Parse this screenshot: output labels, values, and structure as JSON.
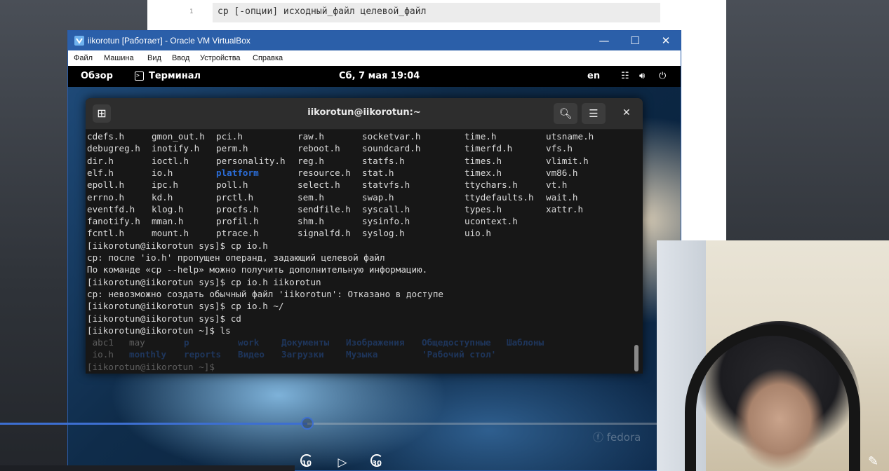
{
  "doc": {
    "line_number": "1",
    "code": "cp [-опции] исходный_файл целевой_файл"
  },
  "vbox": {
    "title": "iikorotun [Работает] - Oracle VM VirtualBox",
    "controls": {
      "minimize": "—",
      "maximize": "☐",
      "close": "✕"
    },
    "menu": [
      "Файл",
      "Машина",
      "Вид",
      "Ввод",
      "Устройства",
      "Справка"
    ]
  },
  "gnome": {
    "overview": "Обзор",
    "app_label": "Терминал",
    "clock": "Сб, 7 мая  19:04",
    "lang": "en",
    "watermark": "fedora"
  },
  "terminal": {
    "title": "iikorotun@iikorotun:~",
    "ls_rows": [
      [
        "cdefs.h",
        "gmon_out.h",
        "pci.h",
        "raw.h",
        "socketvar.h",
        "time.h",
        "utsname.h"
      ],
      [
        "debugreg.h",
        "inotify.h",
        "perm.h",
        "reboot.h",
        "soundcard.h",
        "timerfd.h",
        "vfs.h"
      ],
      [
        "dir.h",
        "ioctl.h",
        "personality.h",
        "reg.h",
        "statfs.h",
        "times.h",
        "vlimit.h"
      ],
      [
        "elf.h",
        "io.h",
        "platform",
        "resource.h",
        "stat.h",
        "timex.h",
        "vm86.h"
      ],
      [
        "epoll.h",
        "ipc.h",
        "poll.h",
        "select.h",
        "statvfs.h",
        "ttychars.h",
        "vt.h"
      ],
      [
        "errno.h",
        "kd.h",
        "prctl.h",
        "sem.h",
        "swap.h",
        "ttydefaults.h",
        "wait.h"
      ],
      [
        "eventfd.h",
        "klog.h",
        "procfs.h",
        "sendfile.h",
        "syscall.h",
        "types.h",
        "xattr.h"
      ],
      [
        "fanotify.h",
        "mman.h",
        "profil.h",
        "shm.h",
        "sysinfo.h",
        "ucontext.h",
        ""
      ],
      [
        "fcntl.h",
        "mount.h",
        "ptrace.h",
        "signalfd.h",
        "syslog.h",
        "uio.h",
        ""
      ]
    ],
    "lines": [
      "[iikorotun@iikorotun sys]$ cp io.h",
      "cp: после 'io.h' пропущен операнд, задающий целевой файл",
      "По команде «cp --help» можно получить дополнительную информацию.",
      "[iikorotun@iikorotun sys]$ cp io.h iikorotun",
      "cp: невозможно создать обычный файл 'iikorotun': Отказано в доступе",
      "[iikorotun@iikorotun sys]$ cp io.h ~/",
      "[iikorotun@iikorotun sys]$ cd",
      "[iikorotun@iikorotun ~]$ ls"
    ],
    "home_ls": [
      [
        " abc1",
        "may",
        "p",
        "work",
        "Документы",
        "Изображения",
        "Общедоступные",
        "Шаблоны"
      ],
      [
        " io.h",
        "monthly",
        "reports",
        "Видео",
        "Загрузки",
        "Музыка",
        "'Рабочий стол'",
        ""
      ]
    ],
    "prompt": "[iikorotun@iikorotun ~]$ "
  },
  "player": {
    "progress": 0.468,
    "rewind_seconds": "10",
    "forward_seconds": "30"
  },
  "colors": {
    "vbox_titlebar": "#2b5fa9",
    "dir_blue": "#2b6dd8",
    "progress": "#3d6fd1"
  }
}
